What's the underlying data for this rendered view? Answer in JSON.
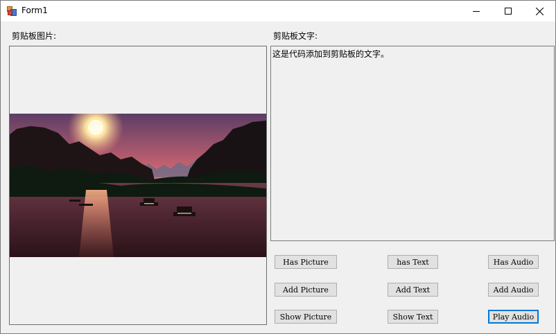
{
  "window": {
    "title": "Form1",
    "controls": {
      "minimize_icon": "minimize-icon",
      "maximize_icon": "maximize-icon",
      "close_icon": "close-icon"
    }
  },
  "picture_panel": {
    "label": "剪贴板图片:",
    "image_description_icon": "landscape-sunset-river-image"
  },
  "text_panel": {
    "label": "剪贴板文字:",
    "content": "这是代码添加到剪贴板的文字。"
  },
  "buttons": {
    "has_picture": "Has Picture",
    "has_text": "has Text",
    "has_audio": "Has Audio",
    "add_picture": "Add Picture",
    "add_text": "Add Text",
    "add_audio": "Add Audio",
    "show_picture": "Show Picture",
    "show_text": "Show Text",
    "play_audio": "Play Audio"
  },
  "colors": {
    "form_background": "#f0f0f0",
    "button_face": "#e1e1e1",
    "focus_border": "#0078d7"
  }
}
